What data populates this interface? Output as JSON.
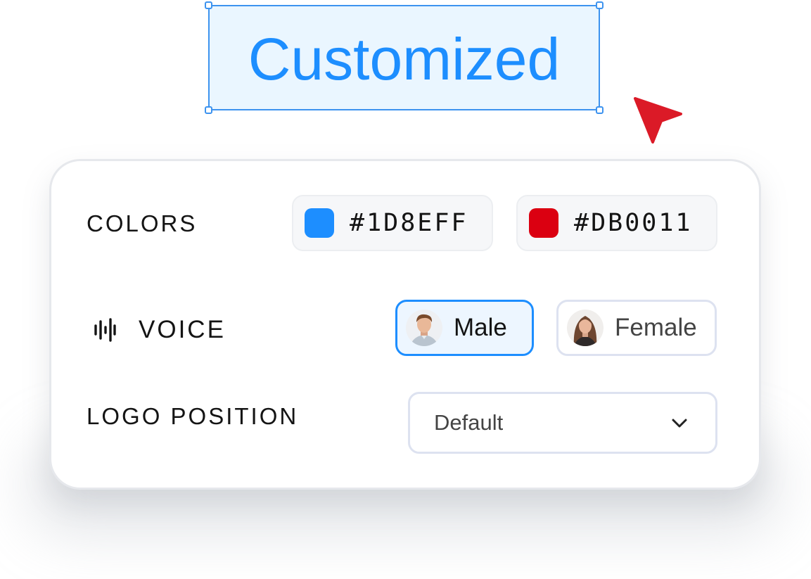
{
  "headline": {
    "text": "Customized"
  },
  "colors": {
    "accent": "#1D8EFF",
    "selection_border": "#3D93EF",
    "selection_fill": "#EAF6FF",
    "cursor": "#DB1A27"
  },
  "settings": {
    "colors_row": {
      "label": "COLORS",
      "swatches": [
        {
          "hex_label": "#1D8EFF",
          "color": "#1D8EFF"
        },
        {
          "hex_label": "#DB0011",
          "color": "#DB0011"
        }
      ]
    },
    "voice_row": {
      "icon": "sound-wave-icon",
      "label": "VOICE",
      "options": [
        {
          "label": "Male",
          "selected": true,
          "avatar": "male-avatar"
        },
        {
          "label": "Female",
          "selected": false,
          "avatar": "female-avatar"
        }
      ]
    },
    "logo_row": {
      "label": "LOGO POSITION",
      "dropdown": {
        "value": "Default",
        "icon": "chevron-down-icon"
      }
    }
  }
}
